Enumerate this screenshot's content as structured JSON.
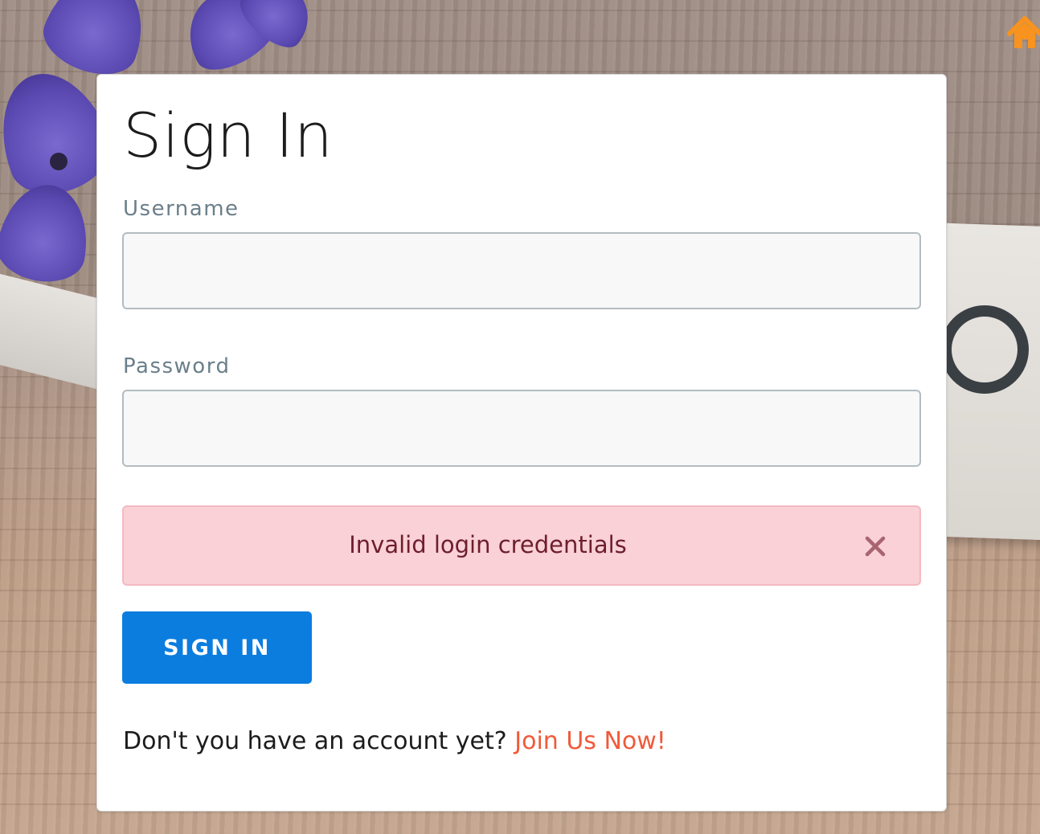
{
  "form": {
    "title": "Sign In",
    "username_label": "Username",
    "username_value": "",
    "password_label": "Password",
    "password_value": "",
    "submit_label": "SIGN IN"
  },
  "alert": {
    "message": "Invalid login credentials"
  },
  "footer": {
    "prompt": "Don't you have an account yet?",
    "link_label": "Join Us Now!"
  },
  "icons": {
    "home": "home-icon",
    "alert_close": "close-icon"
  },
  "colors": {
    "primary_button": "#0b7ddf",
    "alert_background": "#f9d1d6",
    "alert_text": "#6e1e2c",
    "link": "#f05a3a",
    "home_icon": "#f7931e"
  }
}
